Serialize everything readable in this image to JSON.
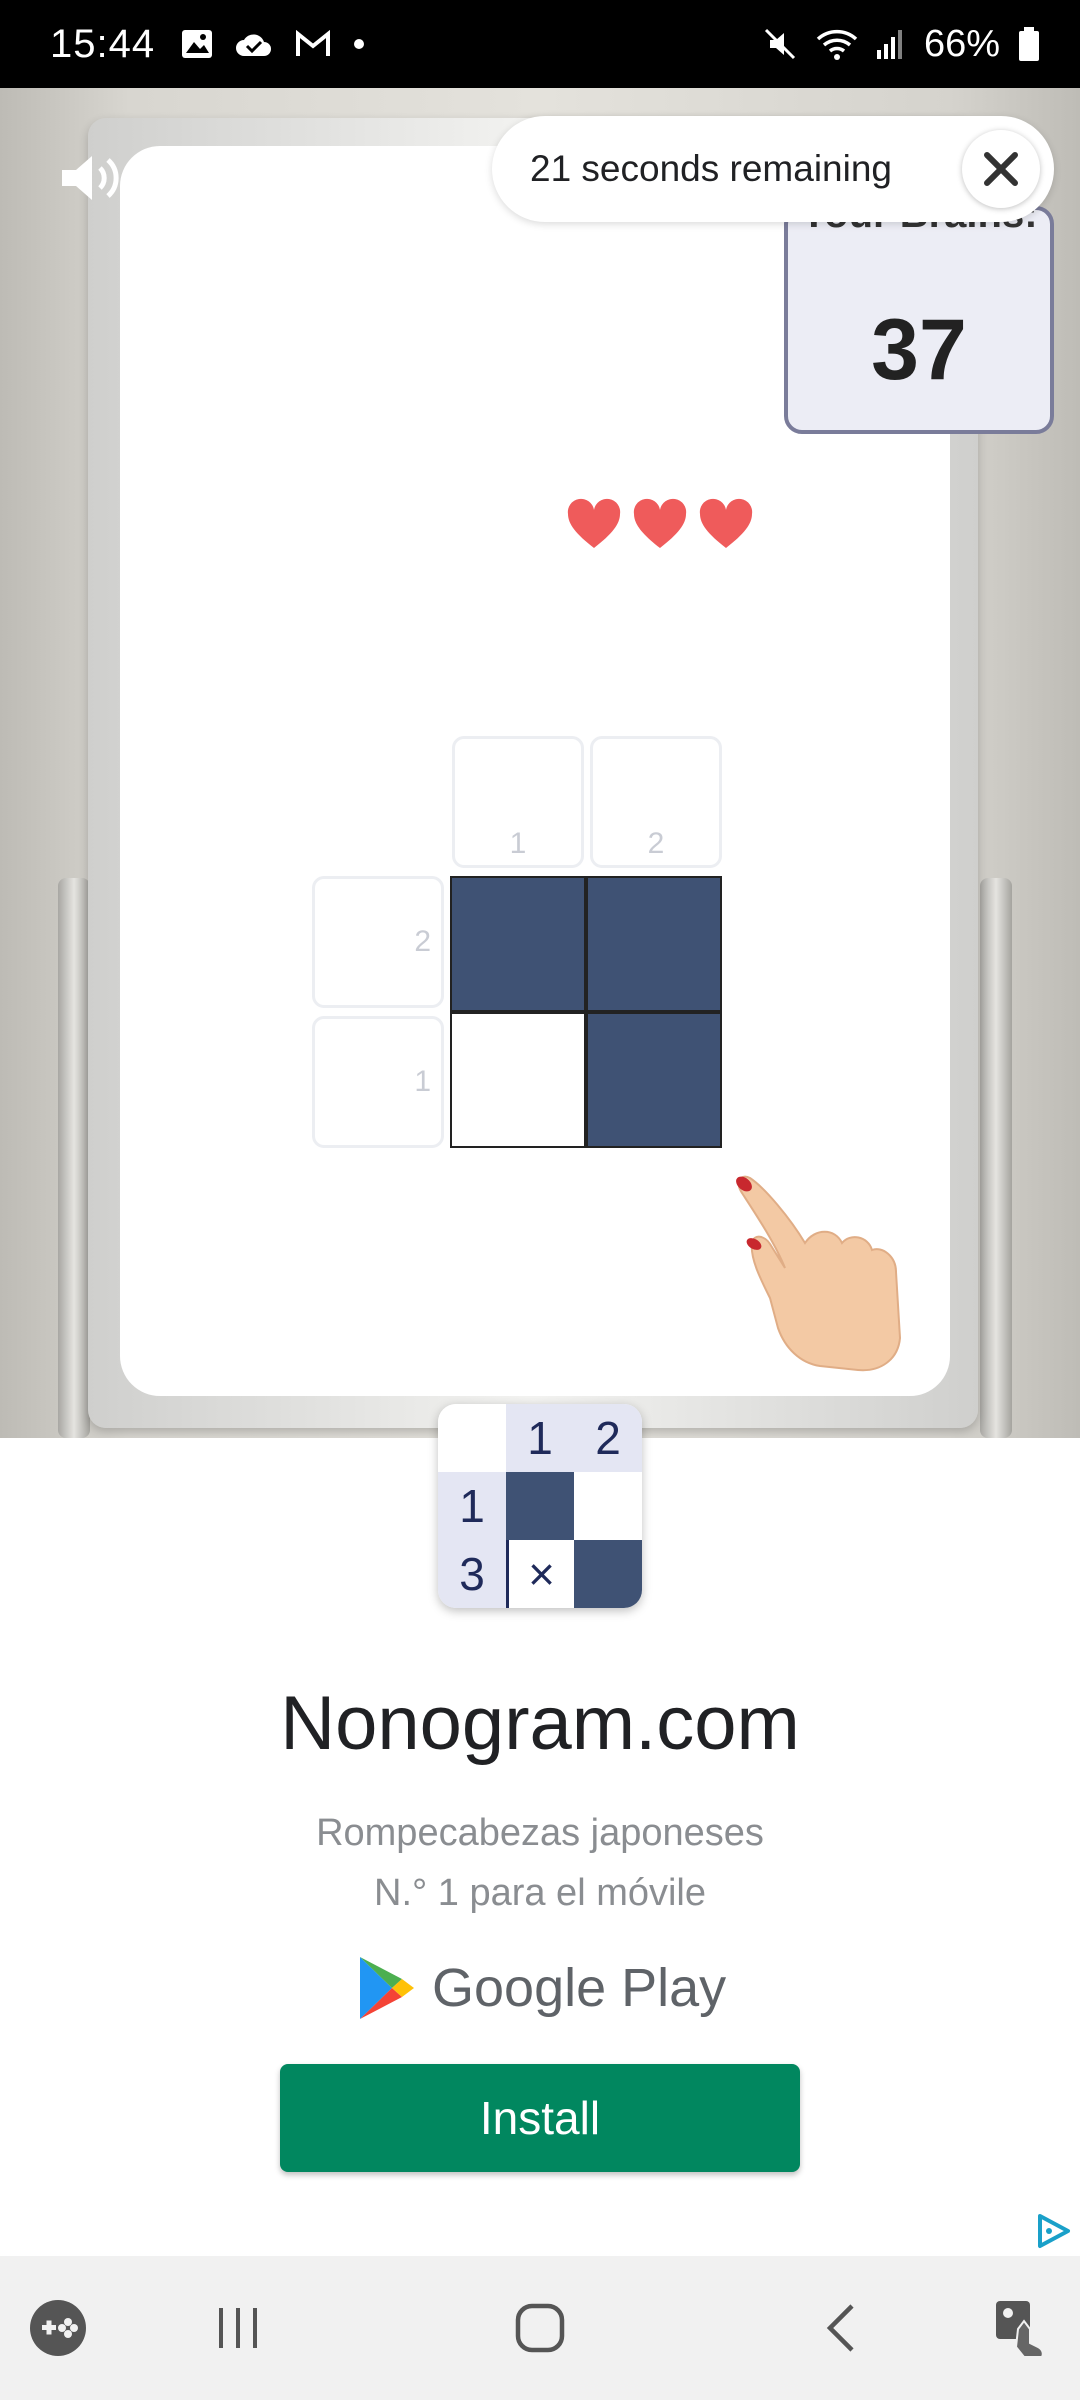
{
  "status_bar": {
    "time": "15:44",
    "battery": "66%",
    "left_icons": [
      "image-icon",
      "cloud-icon",
      "gmail-icon",
      "dot-icon"
    ],
    "right_icons": [
      "mute-icon",
      "wifi-icon",
      "signal-icon",
      "battery-icon"
    ]
  },
  "ad_video": {
    "timer_text": "21 seconds remaining",
    "score_label": "Your Brains:",
    "score_value": "37",
    "hearts": 3,
    "puzzle": {
      "column_clues": [
        "1",
        "2"
      ],
      "row_clues": [
        "2",
        "1"
      ],
      "cells": [
        [
          "filled",
          "filled"
        ],
        [
          "empty",
          "filled"
        ]
      ]
    }
  },
  "app_icon": {
    "column_clues": [
      "1",
      "2"
    ],
    "row_clues": [
      "1",
      "3"
    ],
    "mark": "×"
  },
  "app": {
    "name": "Nonogram.com",
    "tagline_line1": "Rompecabezas japoneses",
    "tagline_line2": "N.° 1 para el móvile",
    "store": "Google Play",
    "install_label": "Install"
  },
  "colors": {
    "install_green": "#01875f",
    "cell_navy": "#3f5274",
    "heart_red": "#ef5b5b"
  }
}
